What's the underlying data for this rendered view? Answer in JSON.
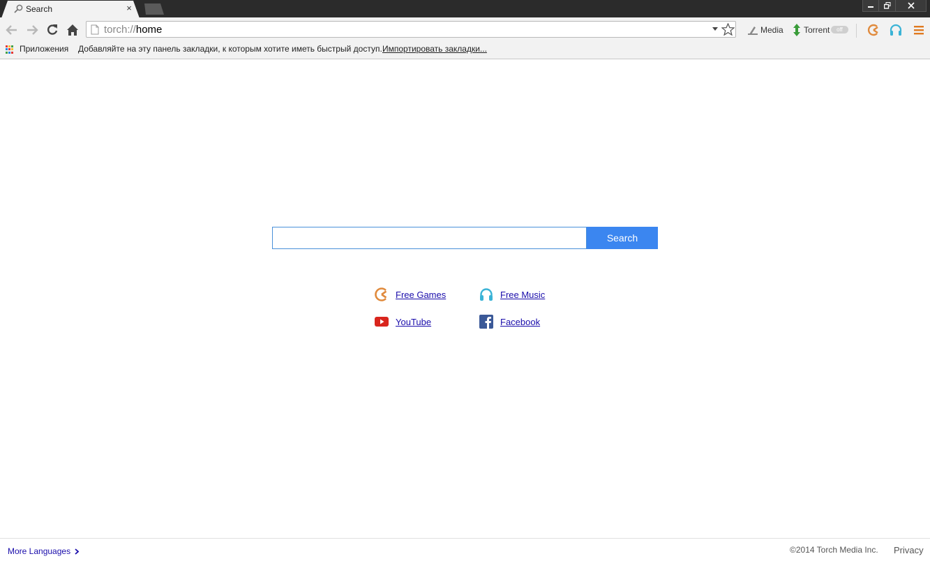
{
  "tab": {
    "title": "Search",
    "close_symbol": "×"
  },
  "window_controls": {
    "minimize": "minimize",
    "restore": "restore",
    "close": "close"
  },
  "toolbar": {
    "url_scheme": "torch://",
    "url_path": "home",
    "extensions": {
      "media_label": "Media",
      "torrent_label": "Torrent",
      "torrent_toggle": "off"
    }
  },
  "bookmarks": {
    "apps_label": "Приложения",
    "hint": "Добавляйте на эту панель закладки, к которым хотите иметь быстрый доступ.",
    "import_link": "Импортировать закладки..."
  },
  "search": {
    "value": "",
    "placeholder": "",
    "button_label": "Search"
  },
  "quick_links": {
    "games": "Free Games",
    "music": "Free Music",
    "youtube": "YouTube",
    "facebook": "Facebook"
  },
  "footer": {
    "more_languages": "More Languages",
    "copyright": "©2014 Torch Media Inc.",
    "privacy": "Privacy"
  },
  "colors": {
    "search_button": "#3b86f0",
    "search_border": "#4a90d9",
    "link": "#1a0dab",
    "games_icon": "#e08a3c",
    "music_icon": "#3ab3d6",
    "youtube_icon": "#d9251d",
    "facebook_icon": "#3b5998"
  }
}
